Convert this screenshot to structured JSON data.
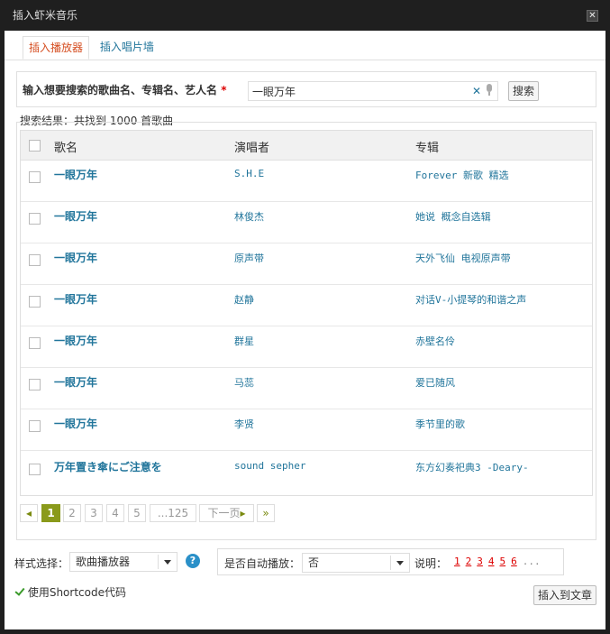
{
  "window": {
    "title": "插入虾米音乐"
  },
  "tabs": [
    {
      "label": "插入播放器",
      "active": true
    },
    {
      "label": "插入唱片墙",
      "active": false
    }
  ],
  "search": {
    "label": "输入想要搜索的歌曲名、专辑名、艺人名",
    "required_mark": "*",
    "value": "一眼万年",
    "button": "搜索"
  },
  "results": {
    "summary": "搜索结果：共找到 1000 首歌曲",
    "headers": {
      "song": "歌名",
      "artist": "演唱者",
      "album": "专辑"
    },
    "rows": [
      {
        "song": "一眼万年",
        "artist": "S.H.E",
        "album": "Forever 新歌 精选"
      },
      {
        "song": "一眼万年",
        "artist": "林俊杰",
        "album": "她说 概念自选辑"
      },
      {
        "song": "一眼万年",
        "artist": "原声带",
        "album": "天外飞仙 电视原声带"
      },
      {
        "song": "一眼万年",
        "artist": "赵静",
        "album": "对话V-小提琴的和谐之声"
      },
      {
        "song": "一眼万年",
        "artist": "群星",
        "album": "赤壁名伶"
      },
      {
        "song": "一眼万年",
        "artist": "马蕊",
        "album": "爱已随风"
      },
      {
        "song": "一眼万年",
        "artist": "李贤",
        "album": "季节里的歌"
      },
      {
        "song": "万年置き傘にご注意を",
        "artist": "sound sepher",
        "album": "东方幻奏祀典3 -Deary-"
      }
    ]
  },
  "pagination": {
    "pages": [
      "1",
      "2",
      "3",
      "4",
      "5",
      "...125"
    ],
    "current": "1",
    "next": "下一页"
  },
  "options": {
    "style_label": "样式选择：",
    "style_value": "歌曲播放器",
    "autoplay_label": "是否自动播放：",
    "autoplay_value": "否",
    "desc_label": "说明：",
    "desc_links": [
      "1",
      "2",
      "3",
      "4",
      "5",
      "6"
    ],
    "desc_more": "...",
    "shortcode_label": "使用Shortcode代码",
    "shortcode_checked": true,
    "insert_button": "插入到文章"
  }
}
